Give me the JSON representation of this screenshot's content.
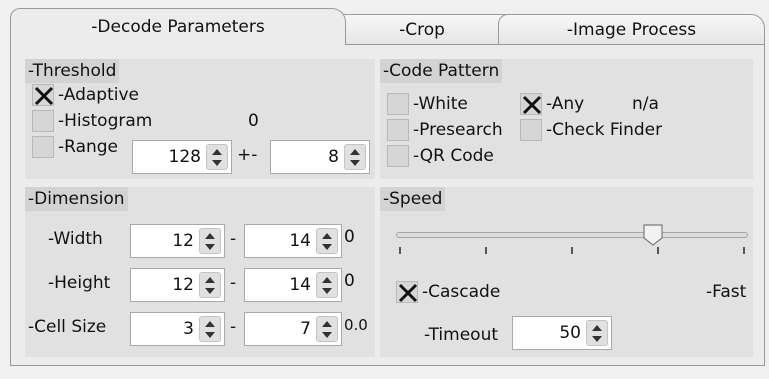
{
  "tabs": [
    {
      "label": "-Decode Parameters",
      "active": true
    },
    {
      "label": "-Crop",
      "active": false
    },
    {
      "label": "-Image Process",
      "active": false
    }
  ],
  "threshold": {
    "title": "-Threshold",
    "adaptive": {
      "label": "-Adaptive",
      "checked": true
    },
    "histogram": {
      "label": "-Histogram",
      "checked": false,
      "value": "0"
    },
    "range": {
      "label": "-Range",
      "checked": false,
      "value": "128",
      "plusminus": "+-",
      "tolerance": "8"
    }
  },
  "code_pattern": {
    "title": "-Code Pattern",
    "white": {
      "label": "-White",
      "checked": false
    },
    "any": {
      "label": "-Any",
      "checked": true,
      "extra": "n/a"
    },
    "presearch": {
      "label": "-Presearch",
      "checked": false
    },
    "check_finder": {
      "label": "-Check Finder",
      "checked": false
    },
    "qr_code": {
      "label": "-QR Code",
      "checked": false
    }
  },
  "dimension": {
    "title": "-Dimension",
    "width": {
      "label": "-Width",
      "min": "12",
      "max": "14",
      "extra": "0"
    },
    "height": {
      "label": "-Height",
      "min": "12",
      "max": "14",
      "extra": "0"
    },
    "cell_size": {
      "label": "-Cell Size",
      "min": "3",
      "max": "7",
      "extra": "0.0"
    },
    "dash": "-"
  },
  "speed": {
    "title": "-Speed",
    "slider_fraction": 0.73,
    "cascade": {
      "label": "-Cascade",
      "checked": true
    },
    "fast_label": "-Fast",
    "timeout": {
      "label": "-Timeout",
      "value": "50"
    }
  }
}
